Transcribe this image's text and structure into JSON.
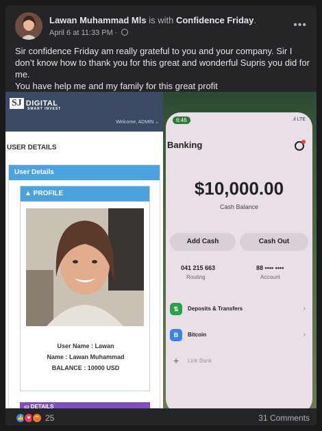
{
  "post": {
    "author": "Lawan Muhammad Mls",
    "with_text": "is with",
    "tagged": "Confidence Friday",
    "period": ".",
    "timestamp": "April 6 at 11:33 PM",
    "dot": "·",
    "more_icon": "more-dots-icon",
    "text_lines": [
      "Sir confidence Friday am really grateful to you and your company. Sir I don’t know how to thank you for this great and wonderful Supris you did for me.",
      "You have help me and my family for this great profit"
    ]
  },
  "left_screenshot": {
    "logo_mark": "SJ",
    "logo_name": "DIGITAL",
    "logo_sub": "SMART INVEST",
    "welcome": "Welcome, ADMIN ⌄",
    "page_title": "USER DETAILS",
    "panel_title": "User Details",
    "profile_title": "▲ PROFILE",
    "user_name": "User Name : Lawan",
    "name": "Name : Lawan Muhammad",
    "balance": "BALANCE : 10000 USD",
    "details_bar": "▭ DETAILS"
  },
  "right_screenshot": {
    "time": "6:46",
    "signal": "LTE",
    "title": "Banking",
    "amount": "$10,000.00",
    "amount_label": "Cash Balance",
    "add_cash": "Add Cash",
    "cash_out": "Cash Out",
    "routing_number": "041 215 663",
    "routing_label": "Routing",
    "account_number": "88 •••• ••••",
    "account_label": "Account",
    "rows": [
      {
        "icon": "⇅",
        "label": "Deposits & Transfers"
      },
      {
        "icon": "B",
        "label": "Bitcoin"
      },
      {
        "icon": "+",
        "label": "Link Bank"
      }
    ]
  },
  "footer": {
    "reaction_count": "25",
    "comments": "31 Comments"
  }
}
